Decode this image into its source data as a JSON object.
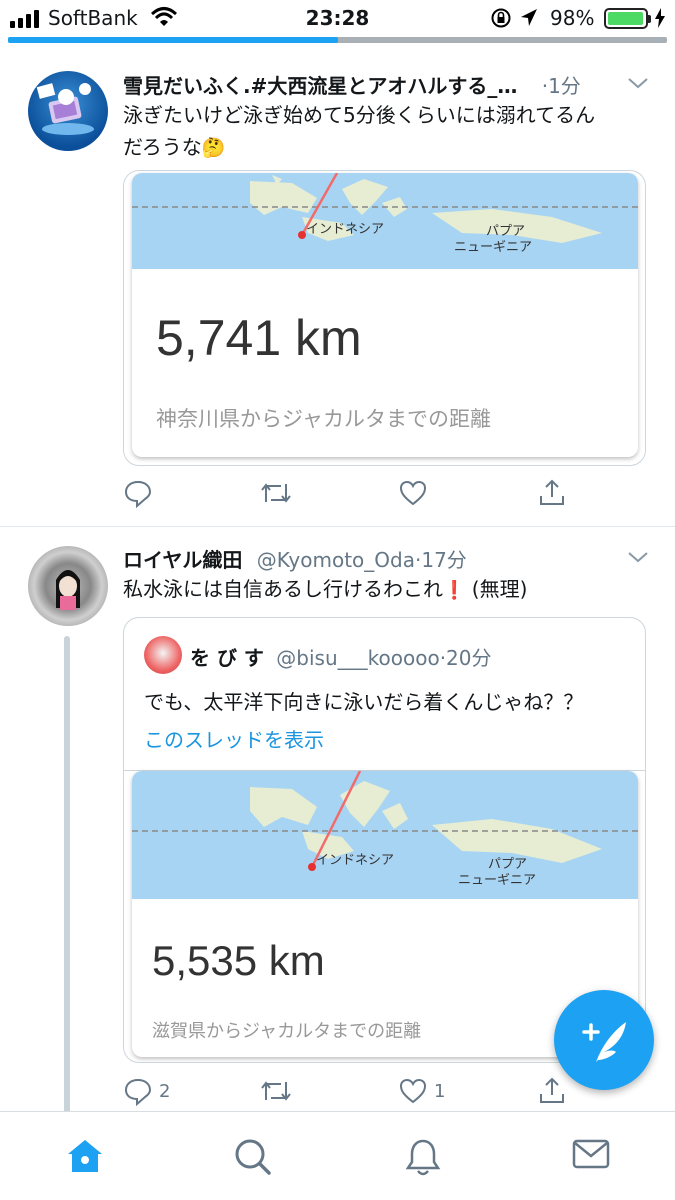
{
  "status_bar": {
    "carrier": "SoftBank",
    "time": "23:28",
    "battery_percent": "98%",
    "battery_level": 0.98
  },
  "timeline_progress": 0.5,
  "tweets": [
    {
      "display_name": "雪見だいふく.#大西流星とアオハルする_…",
      "time": "·1分",
      "text_line1": "泳ぎたいけど泳ぎ始めて5分後くらいには溺れてるん",
      "text_line2": "だろうな",
      "text_emoji": "🤔",
      "card": {
        "map_label_1": "インドネシア",
        "map_label_2a": "パプア",
        "map_label_2b": "ニューギニア",
        "distance": "5,741 km",
        "caption": "神奈川県からジャカルタまでの距離"
      }
    },
    {
      "display_name": "ロイヤル織田",
      "handle": "@Kyomoto_Oda",
      "time": "·17分",
      "text": "私水泳には自信あるし行けるわこれ",
      "text_mark": "❗",
      "text_suffix": " (無理)",
      "reply_count": "2",
      "like_count": "1",
      "quote": {
        "display_name": "を び す",
        "handle": "@bisu___kooooo",
        "time": "·20分",
        "text": "でも、太平洋下向きに泳いだら着くんじゃね？？",
        "thread_link": "このスレッドを表示",
        "card": {
          "map_label_1": "インドネシア",
          "map_label_2a": "パプア",
          "map_label_2b": "ニューギニア",
          "distance": "5,535 km",
          "caption": "滋賀県からジャカルタまでの距離"
        }
      }
    }
  ],
  "colors": {
    "accent": "#1da1f2",
    "link": "#1b95e0",
    "secondary_text": "#657786",
    "map_water": "#a8d4f3",
    "route": "#f26b6b"
  },
  "icons": {
    "reply": "reply-icon",
    "retweet": "retweet-icon",
    "like": "like-icon",
    "share": "share-icon",
    "compose": "compose-tweet-icon",
    "tabs": [
      "home-icon",
      "search-icon",
      "notifications-icon",
      "messages-icon"
    ]
  }
}
